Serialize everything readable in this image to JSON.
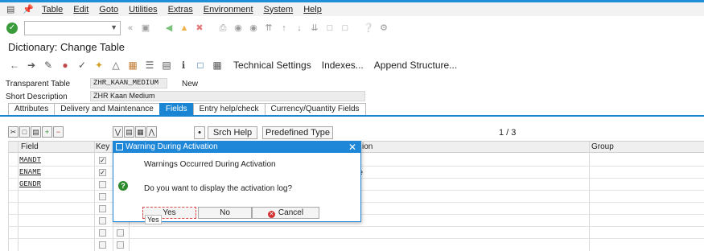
{
  "menu": [
    "Table",
    "Edit",
    "Goto",
    "Utilities",
    "Extras",
    "Environment",
    "System",
    "Help"
  ],
  "title": "Dictionary: Change Table",
  "app_toolbar": {
    "technical_settings": "Technical Settings",
    "indexes": "Indexes...",
    "append_structure": "Append Structure..."
  },
  "header": {
    "transparent_table_label": "Transparent Table",
    "table_name": "ZHR_KAAN_MEDIUM",
    "status": "New",
    "short_description_label": "Short Description",
    "short_description": "ZHR Kaan Medium"
  },
  "tabs": [
    "Attributes",
    "Delivery and Maintenance",
    "Fields",
    "Entry help/check",
    "Currency/Quantity Fields"
  ],
  "active_tab": "Fields",
  "table_toolbar": {
    "srch_help": "Srch Help",
    "predefined_type": "Predefined Type",
    "page": "1 / 3"
  },
  "grid": {
    "columns": [
      "Field",
      "Key",
      "ion",
      "Group"
    ],
    "rows": [
      {
        "field": "MANDT",
        "key": true,
        "desc": ""
      },
      {
        "field": "ENAME",
        "key": true,
        "desc": "e"
      },
      {
        "field": "GENDR",
        "key": false,
        "desc": ""
      }
    ]
  },
  "dialog": {
    "title": "Warning During Activation",
    "message": "Warnings Occurred During Activation",
    "question": "Do you want to display the activation log?",
    "yes": "Yes",
    "no": "No",
    "cancel": "Cancel",
    "tooltip": "Yes"
  },
  "colors": {
    "accent": "#1f87d8",
    "ok_green": "#3a9b3a",
    "cancel_red": "#d23131"
  }
}
